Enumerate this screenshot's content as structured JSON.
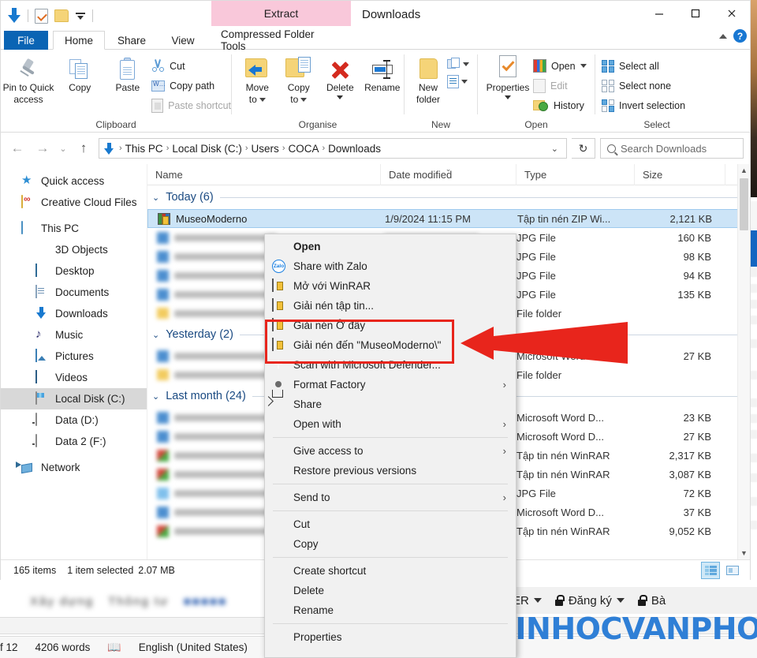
{
  "window": {
    "title": "Downloads",
    "quick_access_toolbar": [
      "download-icon",
      "properties-icon",
      "new-folder-icon",
      "customize-dropdown"
    ],
    "contextual_tab_title": "Extract",
    "controls": {
      "minimize": "−",
      "maximize": "□",
      "close": "✕",
      "help": "?"
    }
  },
  "tabs": [
    {
      "label": "File",
      "key": "file"
    },
    {
      "label": "Home",
      "key": "home"
    },
    {
      "label": "Share",
      "key": "share"
    },
    {
      "label": "View",
      "key": "view"
    },
    {
      "label": "Compressed Folder Tools",
      "key": "cft"
    }
  ],
  "ribbon": {
    "groups": [
      {
        "label": "Clipboard",
        "big": [
          {
            "label": "Pin to Quick\naccess",
            "line1": "Pin to Quick",
            "line2": "access",
            "icon": "pin-icon"
          },
          {
            "label": "Copy",
            "line1": "Copy",
            "line2": "",
            "icon": "copy-icon"
          },
          {
            "label": "Paste",
            "line1": "Paste",
            "line2": "",
            "icon": "paste-icon"
          }
        ],
        "small": [
          {
            "label": "Cut",
            "icon": "scissors-icon",
            "disabled": false
          },
          {
            "label": "Copy path",
            "icon": "copy-path-icon",
            "disabled": false
          },
          {
            "label": "Paste shortcut",
            "icon": "paste-shortcut-icon",
            "disabled": true
          }
        ]
      },
      {
        "label": "Organise",
        "big": [
          {
            "line1": "Move",
            "line2": "to",
            "icon": "move-to-icon",
            "dropdown": true
          },
          {
            "line1": "Copy",
            "line2": "to",
            "icon": "copy-to-icon",
            "dropdown": true
          },
          {
            "line1": "Delete",
            "line2": "",
            "icon": "delete-icon",
            "dropdown": true
          },
          {
            "line1": "Rename",
            "line2": "",
            "icon": "rename-icon",
            "dropdown": false
          }
        ]
      },
      {
        "label": "New",
        "big": [
          {
            "line1": "New",
            "line2": "folder",
            "icon": "new-folder-icon"
          }
        ],
        "mini": [
          {
            "label": "New item",
            "icon": "new-item-icon"
          },
          {
            "label": "Easy access",
            "icon": "easy-access-icon"
          }
        ]
      },
      {
        "label": "Open",
        "big": [
          {
            "line1": "Properties",
            "line2": "",
            "icon": "properties-icon",
            "dropdown": true
          }
        ],
        "small": [
          {
            "label": "Open",
            "icon": "open-rainbow-icon",
            "dropdown": true,
            "disabled": false
          },
          {
            "label": "Edit",
            "icon": "edit-icon",
            "disabled": true
          },
          {
            "label": "History",
            "icon": "history-icon",
            "disabled": false
          }
        ]
      },
      {
        "label": "Select",
        "small": [
          {
            "label": "Select all",
            "icon": "select-all-icon"
          },
          {
            "label": "Select none",
            "icon": "select-none-icon"
          },
          {
            "label": "Invert selection",
            "icon": "invert-selection-icon"
          }
        ]
      }
    ]
  },
  "address_bar": {
    "back": "←",
    "forward": "→",
    "recent": "⌄",
    "up": "↑",
    "breadcrumbs": [
      "This PC",
      "Local Disk (C:)",
      "Users",
      "COCA",
      "Downloads"
    ],
    "dropdown": "⌄",
    "refresh": "↻",
    "search_placeholder": "Search Downloads"
  },
  "sidebar": {
    "items": [
      {
        "label": "Quick access",
        "icon": "star-icon",
        "indent": 0
      },
      {
        "label": "Creative Cloud Files",
        "icon": "creative-cloud-icon",
        "indent": 0
      },
      {
        "label": "This PC",
        "icon": "this-pc-icon",
        "indent": 0
      },
      {
        "label": "3D Objects",
        "icon": "3d-objects-icon",
        "indent": 1
      },
      {
        "label": "Desktop",
        "icon": "desktop-icon",
        "indent": 1
      },
      {
        "label": "Documents",
        "icon": "documents-icon",
        "indent": 1
      },
      {
        "label": "Downloads",
        "icon": "downloads-icon",
        "indent": 1
      },
      {
        "label": "Music",
        "icon": "music-icon",
        "indent": 1
      },
      {
        "label": "Pictures",
        "icon": "pictures-icon",
        "indent": 1
      },
      {
        "label": "Videos",
        "icon": "videos-icon",
        "indent": 1
      },
      {
        "label": "Local Disk (C:)",
        "icon": "local-disk-icon",
        "indent": 1,
        "selected": true
      },
      {
        "label": "Data (D:)",
        "icon": "drive-icon",
        "indent": 1
      },
      {
        "label": "Data 2 (F:)",
        "icon": "drive-icon",
        "indent": 1
      },
      {
        "label": "Network",
        "icon": "network-icon",
        "indent": 0
      }
    ]
  },
  "file_list": {
    "columns": [
      "Name",
      "Date modified",
      "Type",
      "Size"
    ],
    "groups": [
      {
        "header": "Today (6)",
        "rows": [
          {
            "name": "MuseoModerno",
            "date": "1/9/2024 11:15 PM",
            "type": "Tập tin nén ZIP Wi...",
            "size": "2,121 KB",
            "icon": "rar-icon",
            "selected": true,
            "blurred": false
          },
          {
            "name": "",
            "date": "",
            "type": "JPG File",
            "size": "160 KB",
            "icon": "blue-icon",
            "blurred": true
          },
          {
            "name": "",
            "date": "",
            "type": "JPG File",
            "size": "98 KB",
            "icon": "blue-icon",
            "blurred": true
          },
          {
            "name": "",
            "date": "",
            "type": "JPG File",
            "size": "94 KB",
            "icon": "blue-icon",
            "blurred": true
          },
          {
            "name": "",
            "date": "",
            "type": "JPG File",
            "size": "135 KB",
            "icon": "blue-icon",
            "blurred": true
          },
          {
            "name": "",
            "date": "",
            "type": "File folder",
            "size": "",
            "icon": "yellow-icon",
            "blurred": true
          }
        ]
      },
      {
        "header": "Yesterday (2)",
        "rows": [
          {
            "name": "",
            "date": "",
            "type": "Microsoft Word D...",
            "size": "27 KB",
            "icon": "blue-icon",
            "blurred": true
          },
          {
            "name": "",
            "date": "",
            "type": "File folder",
            "size": "",
            "icon": "yellow-icon",
            "blurred": true
          }
        ]
      },
      {
        "header": "Last month (24)",
        "rows": [
          {
            "name": "",
            "date": "",
            "type": "Microsoft Word D...",
            "size": "23 KB",
            "icon": "blue-icon",
            "blurred": true
          },
          {
            "name": "",
            "date": "",
            "type": "Microsoft Word D...",
            "size": "27 KB",
            "icon": "blue-icon",
            "blurred": true
          },
          {
            "name": "",
            "date": "",
            "type": "Tập tin nén WinRAR",
            "size": "2,317 KB",
            "icon": "red-icon",
            "blurred": true
          },
          {
            "name": "",
            "date": "",
            "type": "Tập tin nén WinRAR",
            "size": "3,087 KB",
            "icon": "red-icon",
            "blurred": true
          },
          {
            "name": "",
            "date": "",
            "type": "JPG File",
            "size": "72 KB",
            "icon": "lblue-icon",
            "blurred": true
          },
          {
            "name": "",
            "date": "",
            "type": "Microsoft Word D...",
            "size": "37 KB",
            "icon": "blue-icon",
            "blurred": true
          },
          {
            "name": "",
            "date": "",
            "type": "Tập tin nén WinRAR",
            "size": "9,052 KB",
            "icon": "red-icon",
            "blurred": true
          }
        ]
      }
    ]
  },
  "status_bar": {
    "items_count": "165 items",
    "selected_text": "1 item selected",
    "selected_size": "2.07 MB",
    "view_details": "details-view-icon",
    "view_tiles": "tiles-view-icon"
  },
  "context_menu": {
    "items": [
      {
        "label": "Open",
        "icon": "",
        "bold": true,
        "sep_after": false
      },
      {
        "label": "Share with Zalo",
        "icon": "zalo-icon"
      },
      {
        "label": "Mở với WinRAR",
        "icon": "winrar-icon"
      },
      {
        "label": "Giải nén tập tin...",
        "icon": "winrar-icon"
      },
      {
        "label": "Giải nén Ở đây",
        "icon": "winrar-icon",
        "highlighted": true
      },
      {
        "label": "Giải nén đến \"MuseoModerno\\\"",
        "icon": "winrar-icon",
        "highlighted": true
      },
      {
        "label": "Scan with Microsoft Defender...",
        "icon": "defender-icon"
      },
      {
        "label": "Format Factory",
        "icon": "format-factory-icon",
        "submenu": "›"
      },
      {
        "label": "Share",
        "icon": "share-icon"
      },
      {
        "label": "Open with",
        "icon": "",
        "submenu": "›",
        "sep_after": true
      },
      {
        "label": "Give access to",
        "icon": "",
        "submenu": "›"
      },
      {
        "label": "Restore previous versions",
        "icon": "",
        "sep_after": true
      },
      {
        "label": "Send to",
        "icon": "",
        "submenu": "›",
        "sep_after": true
      },
      {
        "label": "Cut",
        "icon": ""
      },
      {
        "label": "Copy",
        "icon": "",
        "sep_after": true
      },
      {
        "label": "Create shortcut",
        "icon": ""
      },
      {
        "label": "Delete",
        "icon": ""
      },
      {
        "label": "Rename",
        "icon": "",
        "sep_after": true
      },
      {
        "label": "Properties",
        "icon": ""
      }
    ]
  },
  "annotation": {
    "highlight_color": "#e8251c",
    "arrow_color": "#e8251c"
  },
  "background": {
    "word_status": {
      "page": "f 12",
      "words": "4206 words",
      "language": "English (United States)"
    },
    "toolbar_items": [
      {
        "label": "NTER",
        "icon": "",
        "dropdown": true
      },
      {
        "label": "Đăng ký",
        "icon": "lock-icon",
        "dropdown": true
      },
      {
        "label": "Bà",
        "icon": "lock-icon",
        "dropdown": false
      }
    ],
    "watermark_text": "TINHOCVANPHONG"
  }
}
